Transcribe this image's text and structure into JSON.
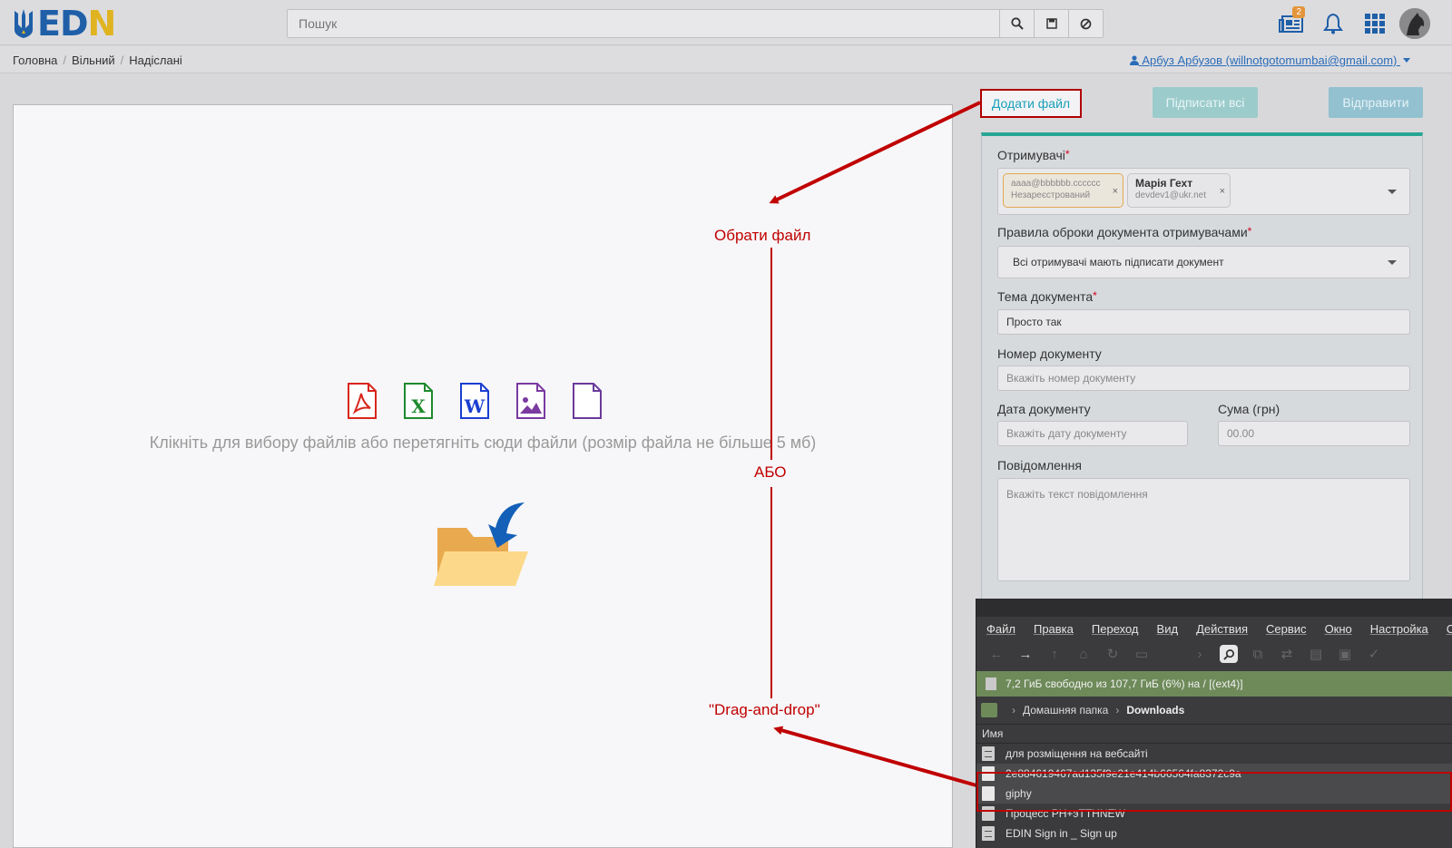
{
  "header": {
    "logo_text_1": "ED",
    "logo_text_2": "N",
    "search_placeholder": "Пошук",
    "search_icons": [
      "search-icon",
      "save-icon",
      "clear-icon"
    ],
    "news_badge": "2",
    "right_icons": [
      "news-icon",
      "bell-icon",
      "apps-grid-icon",
      "avatar"
    ]
  },
  "breadcrumb": {
    "items": [
      "Головна",
      "Вільний",
      "Надіслані"
    ],
    "user": "Арбуз Арбузов (willnotgotomumbai@gmail.com)"
  },
  "toolbar": {
    "add_file": "Додати файл",
    "sign_all": "Підписати всі",
    "send": "Відправити"
  },
  "dropzone": {
    "file_types": [
      "pdf-icon",
      "excel-icon",
      "word-icon",
      "image-icon",
      "file-icon"
    ],
    "hint": "Клікніть для вибору файлів або перетягніть сюди файли (розмір файла не більше 5 мб)"
  },
  "form": {
    "recipients_label": "Отримувачі",
    "recipients": [
      {
        "line1": "aaaa@bbbbbb.cccccc",
        "line2": "Незареєстрований"
      },
      {
        "line1": "Марія Гехт",
        "line2": "devdev1@ukr.net"
      }
    ],
    "rules_label": "Правила оброки документа отримувачами",
    "rules_value": "Всі отримувачі мають підписати документ",
    "topic_label": "Тема документа",
    "topic_value": "Просто так",
    "number_label": "Номер документу",
    "number_placeholder": "Вкажіть номер документу",
    "date_label": "Дата документу",
    "date_placeholder": "Вкажіть дату документу",
    "sum_label": "Сума (грн)",
    "sum_placeholder": "00.00",
    "message_label": "Повідомлення",
    "message_placeholder": "Вкажіть текст повідомлення"
  },
  "annotations": {
    "choose_file": "Обрати файл",
    "or": "АБО",
    "drag_drop": "\"Drag-and-drop\"",
    "color": "#c00000"
  },
  "file_manager": {
    "menu": [
      "Файл",
      "Правка",
      "Переход",
      "Вид",
      "Действия",
      "Сервис",
      "Окно",
      "Настройка",
      "Сп"
    ],
    "free_space": "7,2 ГиБ свободно из 107,7 ГиБ (6%) на / [(ext4)]",
    "path_home": "Домашняя папка",
    "path_current": "Downloads",
    "column_name": "Имя",
    "files": [
      "для розміщення на вебсайті",
      "2e884619467ad135f9e21e414b66564fa8372c9a",
      "giphy",
      "Процесс PH+эTTHNEW",
      "EDIN Sign in _ Sign up"
    ]
  },
  "colors": {
    "accent_teal": "#25a794",
    "link_blue": "#2b6cb8",
    "brand_blue": "#1f5fa8",
    "brand_yellow": "#e0b321"
  }
}
